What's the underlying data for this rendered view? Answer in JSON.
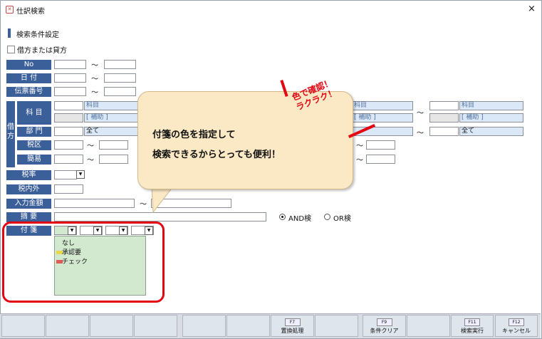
{
  "window": {
    "title": "仕訳検索",
    "close_symbol": "×"
  },
  "section": {
    "title": "検索条件設定"
  },
  "checkbox": {
    "label": "借方または貸方"
  },
  "labels": {
    "no": "No",
    "date": "日 付",
    "slip": "伝票番号",
    "debit": "借方",
    "account": "科 目",
    "dept": "部 門",
    "tax_class": "税区",
    "simple": "簡易",
    "tax_rate": "税率",
    "tax_incl": "税内外",
    "amount": "入力金額",
    "memo": "摘 要",
    "fusen": "付 箋"
  },
  "fields": {
    "account_placeholder": "科目",
    "aux_placeholder": "[ 補助 ]",
    "dept_value": "全て",
    "tilde": "～"
  },
  "search_mode": {
    "and_label": "AND検",
    "or_label": "OR検",
    "selected": "AND"
  },
  "fusen_list": {
    "items": [
      {
        "label": "なし",
        "color": ""
      },
      {
        "label": "承認要",
        "color": "#e8d84a"
      },
      {
        "label": "チェック",
        "color": "#e05a5a"
      }
    ]
  },
  "callout": {
    "line1": "付箋の色を指定して",
    "line2": "検索できるからとっても便利！",
    "stamp_line1": "色で確認！",
    "stamp_line2": "ラクラク！"
  },
  "fkeys": [
    {
      "key": "",
      "label": ""
    },
    {
      "key": "",
      "label": ""
    },
    {
      "key": "",
      "label": ""
    },
    {
      "key": "",
      "label": ""
    },
    {
      "key": "",
      "label": ""
    },
    {
      "key": "F7",
      "label": "置換処理"
    },
    {
      "key": "",
      "label": ""
    },
    {
      "key": "F9",
      "label": "条件クリア"
    },
    {
      "key": "",
      "label": ""
    },
    {
      "key": "F11",
      "label": "検索実行"
    },
    {
      "key": "F12",
      "label": "キャンセル"
    }
  ],
  "colors": {
    "label_bg": "#3b5f98",
    "highlight": "#e30613",
    "callout_bg": "#fbe8c4",
    "list_bg": "#d2e8cf"
  }
}
